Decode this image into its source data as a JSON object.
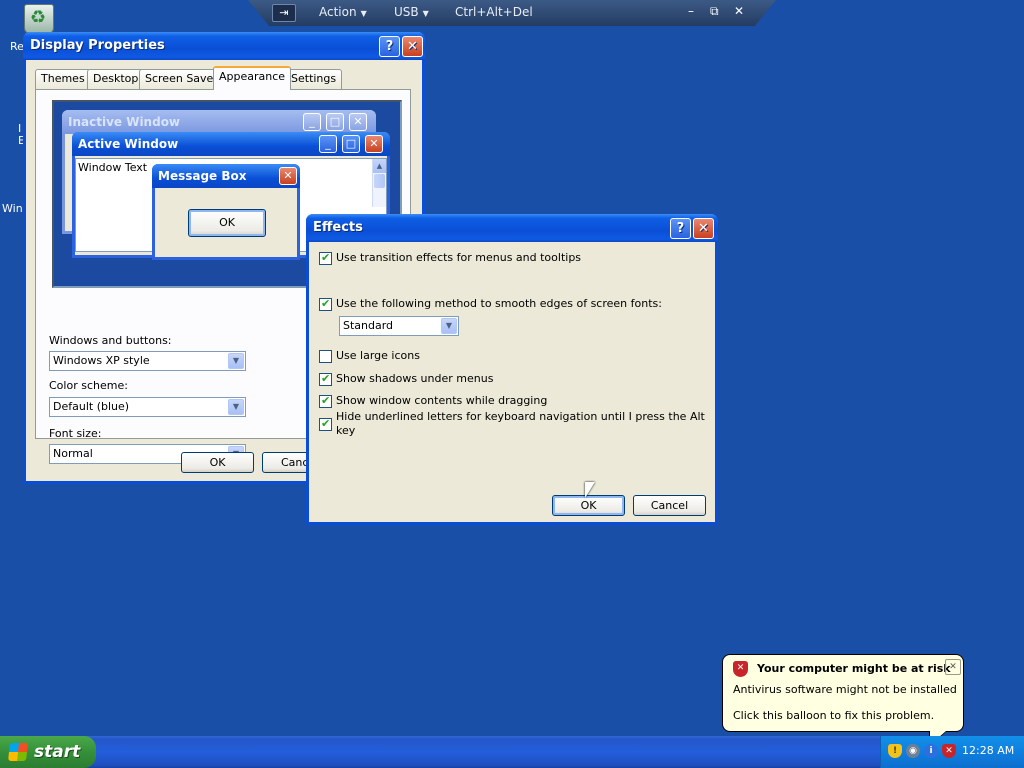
{
  "vm_bar": {
    "pin_glyph": "⇥",
    "menus": [
      "Action",
      "USB",
      "Ctrl+Alt+Del"
    ],
    "controls": [
      "–",
      "⧉",
      "✕"
    ]
  },
  "desktop": {
    "icon_labels": [
      "Re",
      "I",
      "E",
      "Wind"
    ]
  },
  "display_properties": {
    "title": "Display Properties",
    "help_glyph": "?",
    "close_glyph": "✕",
    "tabs": [
      "Themes",
      "Desktop",
      "Screen Saver",
      "Appearance",
      "Settings"
    ],
    "active_tab": "Appearance",
    "preview": {
      "inactive_title": "Inactive Window",
      "active_title": "Active Window",
      "window_text": "Window Text",
      "message_box_title": "Message Box",
      "message_box_ok": "OK"
    },
    "windows_buttons_label": "Windows and buttons:",
    "windows_buttons_value": "Windows XP style",
    "color_scheme_label": "Color scheme:",
    "color_scheme_value": "Default (blue)",
    "font_size_label": "Font size:",
    "font_size_value": "Normal",
    "ok_label": "OK",
    "cancel_label": "Canc"
  },
  "effects": {
    "title": "Effects",
    "help_glyph": "?",
    "close_glyph": "✕",
    "options": [
      {
        "label": "Use transition effects for menus and tooltips",
        "checked": true
      },
      {
        "label": "Use the following method to smooth edges of screen fonts:",
        "checked": true
      },
      {
        "label": "Use large icons",
        "checked": false
      },
      {
        "label": "Show shadows under menus",
        "checked": true
      },
      {
        "label": "Show window contents while dragging",
        "checked": true
      },
      {
        "label": "Hide underlined letters for keyboard navigation until I press the Alt key",
        "checked": true
      }
    ],
    "smoothing_value": "Standard",
    "ok_label": "OK",
    "cancel_label": "Cancel"
  },
  "balloon": {
    "title": "Your computer might be at risk",
    "line1": "Antivirus software might not be installed",
    "line2": "Click this balloon to fix this problem.",
    "close_glyph": "✕"
  },
  "taskbar": {
    "start_label": "start",
    "clock": "12:28 AM"
  }
}
